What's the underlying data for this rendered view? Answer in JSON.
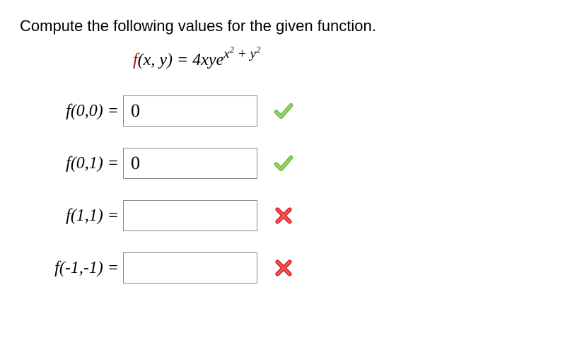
{
  "prompt": "Compute the following values for the given function.",
  "formula": {
    "lhs_fn": "f",
    "lhs_args": "(x, y)",
    "eq": " = ",
    "coeff": "4",
    "body": "xye",
    "exp_left": "x",
    "exp_left_sup": "2",
    "exp_plus": " + ",
    "exp_right": "y",
    "exp_right_sup": "2"
  },
  "rows": [
    {
      "label_fn": "f",
      "label_args": "(0,0) =",
      "value": "0",
      "status": "correct"
    },
    {
      "label_fn": "f",
      "label_args": "(0,1) =",
      "value": "0",
      "status": "correct"
    },
    {
      "label_fn": "f",
      "label_args": "(1,1) =",
      "value": "",
      "status": "incorrect"
    },
    {
      "label_fn": "f",
      "label_args": "(-1,-1) =",
      "value": "",
      "status": "incorrect"
    }
  ]
}
